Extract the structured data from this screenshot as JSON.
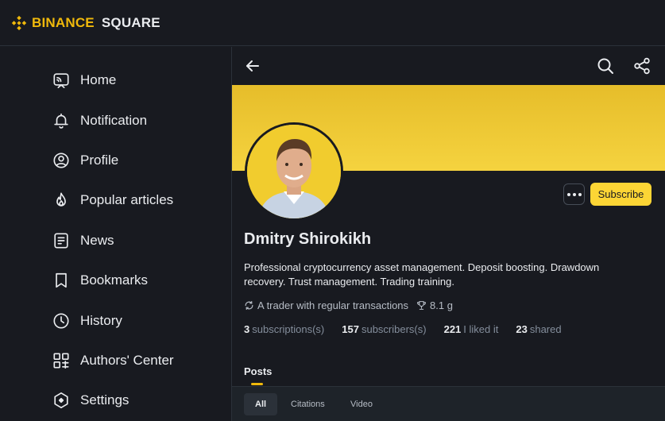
{
  "brand": {
    "part1": "BINANCE",
    "part2": "SQUARE",
    "color": "#F0B90B"
  },
  "sidebar": {
    "items": [
      {
        "label": "Home",
        "icon": "home-icon"
      },
      {
        "label": "Notification",
        "icon": "bell-icon"
      },
      {
        "label": "Profile",
        "icon": "user-circle-icon"
      },
      {
        "label": "Popular articles",
        "icon": "fire-icon"
      },
      {
        "label": "News",
        "icon": "news-icon"
      },
      {
        "label": "Bookmarks",
        "icon": "bookmark-icon"
      },
      {
        "label": "History",
        "icon": "clock-icon"
      },
      {
        "label": "Authors' Center",
        "icon": "grid-icon"
      },
      {
        "label": "Settings",
        "icon": "settings-icon"
      }
    ]
  },
  "header": {
    "back_icon": "arrow-left-icon",
    "search_icon": "search-icon",
    "share_icon": "share-icon"
  },
  "profile": {
    "name": "Dmitry Shirokikh",
    "bio": "Professional cryptocurrency asset management. Deposit boosting. Drawdown recovery. Trust management. Trading training.",
    "badge_trader": "A trader with regular transactions",
    "badge_weight": "8.1 g",
    "subscribe_label": "Subscribe",
    "banner_color": "#F3D03A",
    "accent_color": "#FCD535",
    "stats": [
      {
        "num": "3",
        "label": "subscriptions(s)"
      },
      {
        "num": "157",
        "label": "subscribers(s)"
      },
      {
        "num": "221",
        "label": "I liked it"
      },
      {
        "num": "23",
        "label": "shared"
      }
    ]
  },
  "tabs": {
    "main": "Posts",
    "sub": [
      "All",
      "Citations",
      "Video"
    ],
    "active_sub": "All"
  }
}
